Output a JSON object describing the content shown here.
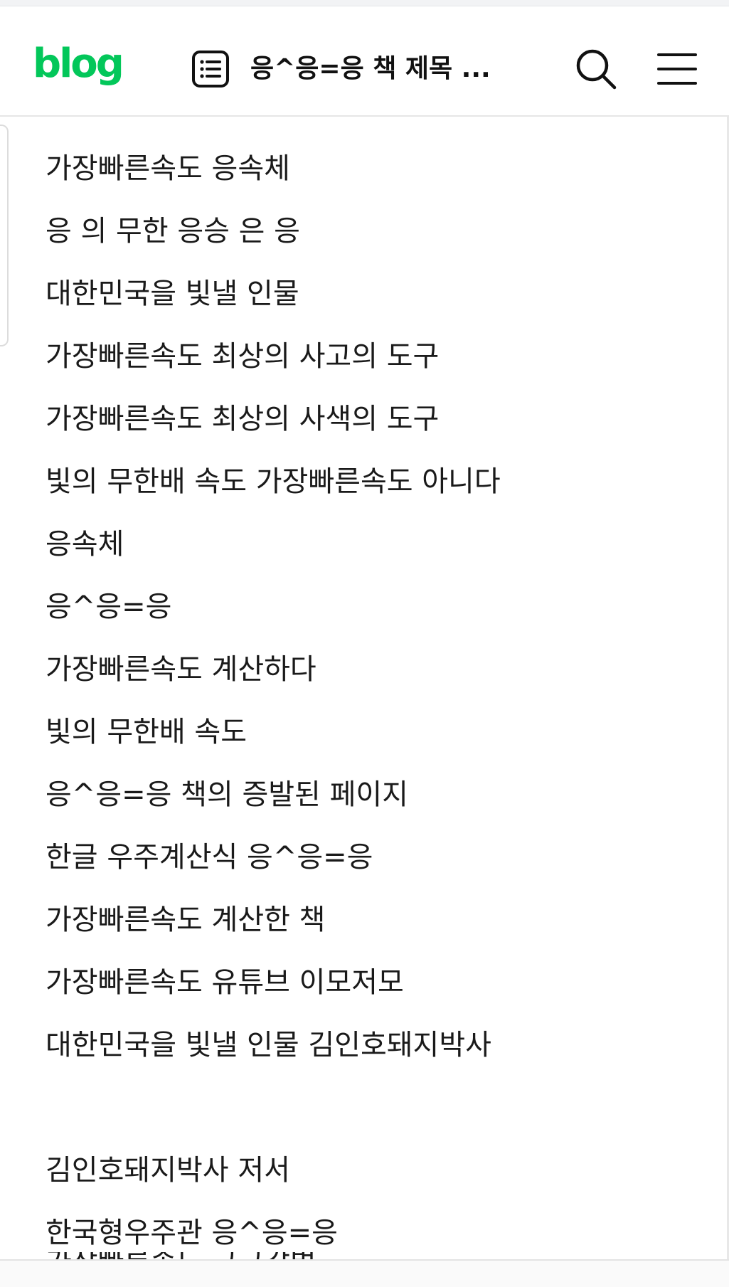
{
  "header": {
    "logo_text": "blog",
    "post_title": "응^응=응 책 제목 ...",
    "post_icon": "post-list-icon",
    "search_icon": "search-icon",
    "menu_icon": "hamburger-menu-icon",
    "brand_color": "#03c75a"
  },
  "content": {
    "lines": [
      "가장빠른속도 응속체",
      "응 의 무한 응승 은 응",
      "대한민국을 빛낼 인물",
      "가장빠른속도 최상의 사고의 도구",
      "가장빠른속도 최상의 사색의 도구",
      "빛의 무한배 속도 가장빠른속도 아니다",
      "응속체",
      "응^응=응",
      "가장빠른속도 계산하다",
      "빛의 무한배 속도",
      "응^응=응 책의 증발된 페이지",
      "한글 우주계산식 응^응=응",
      "가장빠른속도 계산한 책",
      "가장빠른속도 유튜브 이모저모",
      "대한민국을 빛낼 인물 김인호돼지박사",
      "",
      "김인호돼지박사 저서",
      "한국형우주관 응^응=응",
      "가장빠른속도 근근감법"
    ]
  }
}
